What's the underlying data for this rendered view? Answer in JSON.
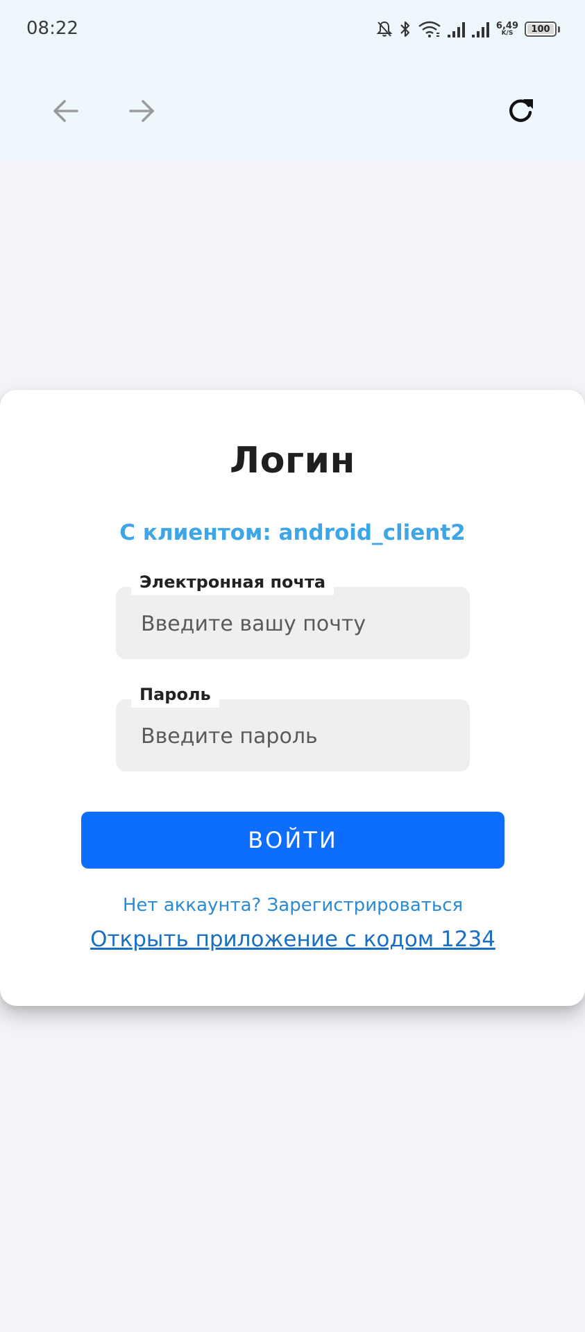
{
  "status_bar": {
    "time": "08:22",
    "net_speed_value": "6,49",
    "net_speed_unit": "K/S",
    "battery_level": "100",
    "icons": [
      "bell-off-icon",
      "bluetooth-icon",
      "wifi-icon",
      "signal-icon",
      "signal-icon"
    ]
  },
  "nav": {
    "back_icon": "arrow-left-icon",
    "forward_icon": "arrow-right-icon",
    "reload_icon": "refresh-icon"
  },
  "login": {
    "title": "Логин",
    "client_label": "С клиентом: android_client2",
    "email_label": "Электронная почта",
    "email_placeholder": "Введите вашу почту",
    "email_value": "",
    "password_label": "Пароль",
    "password_placeholder": "Введите пароль",
    "password_value": "",
    "submit_label": "ВОЙТИ",
    "register_link": "Нет аккаунта? Зарегистрироваться",
    "open_app_link": "Открыть приложение с кодом 1234"
  },
  "colors": {
    "top_area": "#eef7fc",
    "page_background": "#f3f4f7",
    "accent_client": "#3ea6e6",
    "button": "#0d6efd",
    "link": "#2b8ad4"
  }
}
